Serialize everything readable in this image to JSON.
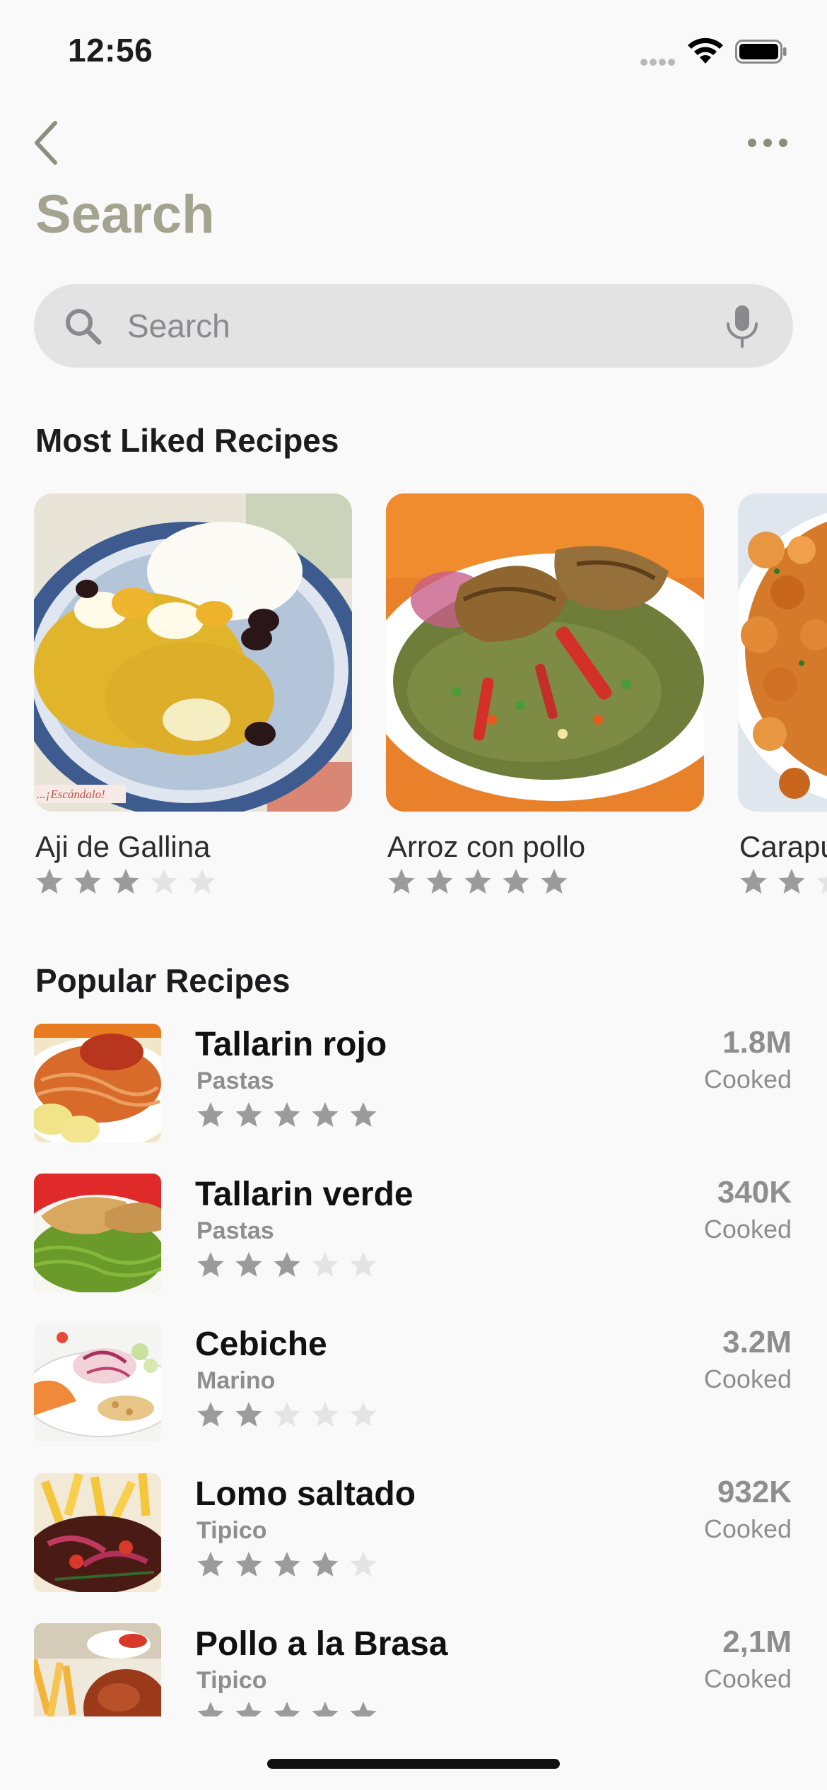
{
  "status_bar": {
    "time": "12:56"
  },
  "header": {
    "title": "Search"
  },
  "search": {
    "placeholder": "Search",
    "value": ""
  },
  "most_liked": {
    "title": "Most Liked Recipes",
    "items": [
      {
        "name": "Aji de Gallina",
        "rating": 3,
        "image_watermark": "...¡Escándalo!"
      },
      {
        "name": "Arroz con pollo",
        "rating": 5
      },
      {
        "name": "Carapulcra",
        "rating": 2
      }
    ]
  },
  "popular": {
    "title": "Popular Recipes",
    "items": [
      {
        "name": "Tallarin rojo",
        "category": "Pastas",
        "rating": 5,
        "count": "1.8M",
        "count_label": "Cooked"
      },
      {
        "name": "Tallarin verde",
        "category": "Pastas",
        "rating": 3,
        "count": "340K",
        "count_label": "Cooked"
      },
      {
        "name": "Cebiche",
        "category": "Marino",
        "rating": 2,
        "count": "3.2M",
        "count_label": "Cooked"
      },
      {
        "name": "Lomo saltado",
        "category": "Tipico",
        "rating": 4,
        "count": "932K",
        "count_label": "Cooked"
      },
      {
        "name": "Pollo a la Brasa",
        "category": "Tipico",
        "rating": 5,
        "count": "2,1M",
        "count_label": "Cooked"
      }
    ]
  },
  "colors": {
    "title": "#a3a38f",
    "star_filled": "#9b9b9b",
    "star_empty": "#e4e4e4",
    "search_bg": "#e3e3e3"
  }
}
